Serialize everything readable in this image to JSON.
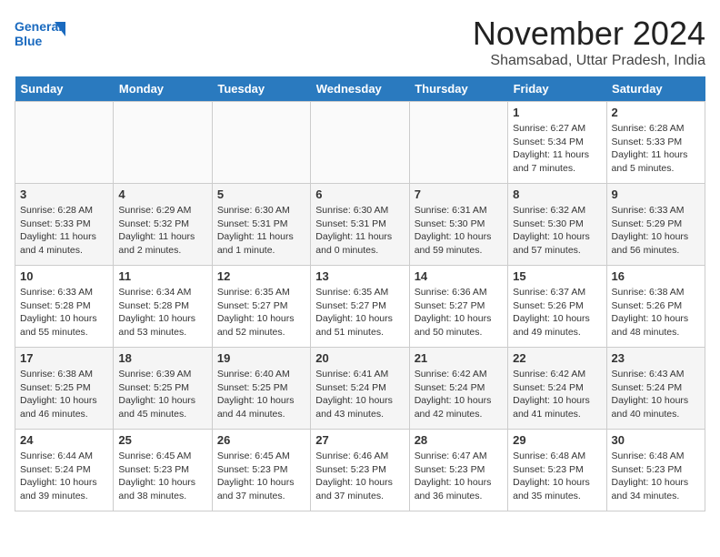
{
  "logo": {
    "line1": "General",
    "line2": "Blue"
  },
  "title": "November 2024",
  "location": "Shamsabad, Uttar Pradesh, India",
  "weekdays": [
    "Sunday",
    "Monday",
    "Tuesday",
    "Wednesday",
    "Thursday",
    "Friday",
    "Saturday"
  ],
  "rows": [
    [
      {
        "day": "",
        "info": ""
      },
      {
        "day": "",
        "info": ""
      },
      {
        "day": "",
        "info": ""
      },
      {
        "day": "",
        "info": ""
      },
      {
        "day": "",
        "info": ""
      },
      {
        "day": "1",
        "info": "Sunrise: 6:27 AM\nSunset: 5:34 PM\nDaylight: 11 hours\nand 7 minutes."
      },
      {
        "day": "2",
        "info": "Sunrise: 6:28 AM\nSunset: 5:33 PM\nDaylight: 11 hours\nand 5 minutes."
      }
    ],
    [
      {
        "day": "3",
        "info": "Sunrise: 6:28 AM\nSunset: 5:33 PM\nDaylight: 11 hours\nand 4 minutes."
      },
      {
        "day": "4",
        "info": "Sunrise: 6:29 AM\nSunset: 5:32 PM\nDaylight: 11 hours\nand 2 minutes."
      },
      {
        "day": "5",
        "info": "Sunrise: 6:30 AM\nSunset: 5:31 PM\nDaylight: 11 hours\nand 1 minute."
      },
      {
        "day": "6",
        "info": "Sunrise: 6:30 AM\nSunset: 5:31 PM\nDaylight: 11 hours\nand 0 minutes."
      },
      {
        "day": "7",
        "info": "Sunrise: 6:31 AM\nSunset: 5:30 PM\nDaylight: 10 hours\nand 59 minutes."
      },
      {
        "day": "8",
        "info": "Sunrise: 6:32 AM\nSunset: 5:30 PM\nDaylight: 10 hours\nand 57 minutes."
      },
      {
        "day": "9",
        "info": "Sunrise: 6:33 AM\nSunset: 5:29 PM\nDaylight: 10 hours\nand 56 minutes."
      }
    ],
    [
      {
        "day": "10",
        "info": "Sunrise: 6:33 AM\nSunset: 5:28 PM\nDaylight: 10 hours\nand 55 minutes."
      },
      {
        "day": "11",
        "info": "Sunrise: 6:34 AM\nSunset: 5:28 PM\nDaylight: 10 hours\nand 53 minutes."
      },
      {
        "day": "12",
        "info": "Sunrise: 6:35 AM\nSunset: 5:27 PM\nDaylight: 10 hours\nand 52 minutes."
      },
      {
        "day": "13",
        "info": "Sunrise: 6:35 AM\nSunset: 5:27 PM\nDaylight: 10 hours\nand 51 minutes."
      },
      {
        "day": "14",
        "info": "Sunrise: 6:36 AM\nSunset: 5:27 PM\nDaylight: 10 hours\nand 50 minutes."
      },
      {
        "day": "15",
        "info": "Sunrise: 6:37 AM\nSunset: 5:26 PM\nDaylight: 10 hours\nand 49 minutes."
      },
      {
        "day": "16",
        "info": "Sunrise: 6:38 AM\nSunset: 5:26 PM\nDaylight: 10 hours\nand 48 minutes."
      }
    ],
    [
      {
        "day": "17",
        "info": "Sunrise: 6:38 AM\nSunset: 5:25 PM\nDaylight: 10 hours\nand 46 minutes."
      },
      {
        "day": "18",
        "info": "Sunrise: 6:39 AM\nSunset: 5:25 PM\nDaylight: 10 hours\nand 45 minutes."
      },
      {
        "day": "19",
        "info": "Sunrise: 6:40 AM\nSunset: 5:25 PM\nDaylight: 10 hours\nand 44 minutes."
      },
      {
        "day": "20",
        "info": "Sunrise: 6:41 AM\nSunset: 5:24 PM\nDaylight: 10 hours\nand 43 minutes."
      },
      {
        "day": "21",
        "info": "Sunrise: 6:42 AM\nSunset: 5:24 PM\nDaylight: 10 hours\nand 42 minutes."
      },
      {
        "day": "22",
        "info": "Sunrise: 6:42 AM\nSunset: 5:24 PM\nDaylight: 10 hours\nand 41 minutes."
      },
      {
        "day": "23",
        "info": "Sunrise: 6:43 AM\nSunset: 5:24 PM\nDaylight: 10 hours\nand 40 minutes."
      }
    ],
    [
      {
        "day": "24",
        "info": "Sunrise: 6:44 AM\nSunset: 5:24 PM\nDaylight: 10 hours\nand 39 minutes."
      },
      {
        "day": "25",
        "info": "Sunrise: 6:45 AM\nSunset: 5:23 PM\nDaylight: 10 hours\nand 38 minutes."
      },
      {
        "day": "26",
        "info": "Sunrise: 6:45 AM\nSunset: 5:23 PM\nDaylight: 10 hours\nand 37 minutes."
      },
      {
        "day": "27",
        "info": "Sunrise: 6:46 AM\nSunset: 5:23 PM\nDaylight: 10 hours\nand 37 minutes."
      },
      {
        "day": "28",
        "info": "Sunrise: 6:47 AM\nSunset: 5:23 PM\nDaylight: 10 hours\nand 36 minutes."
      },
      {
        "day": "29",
        "info": "Sunrise: 6:48 AM\nSunset: 5:23 PM\nDaylight: 10 hours\nand 35 minutes."
      },
      {
        "day": "30",
        "info": "Sunrise: 6:48 AM\nSunset: 5:23 PM\nDaylight: 10 hours\nand 34 minutes."
      }
    ]
  ]
}
